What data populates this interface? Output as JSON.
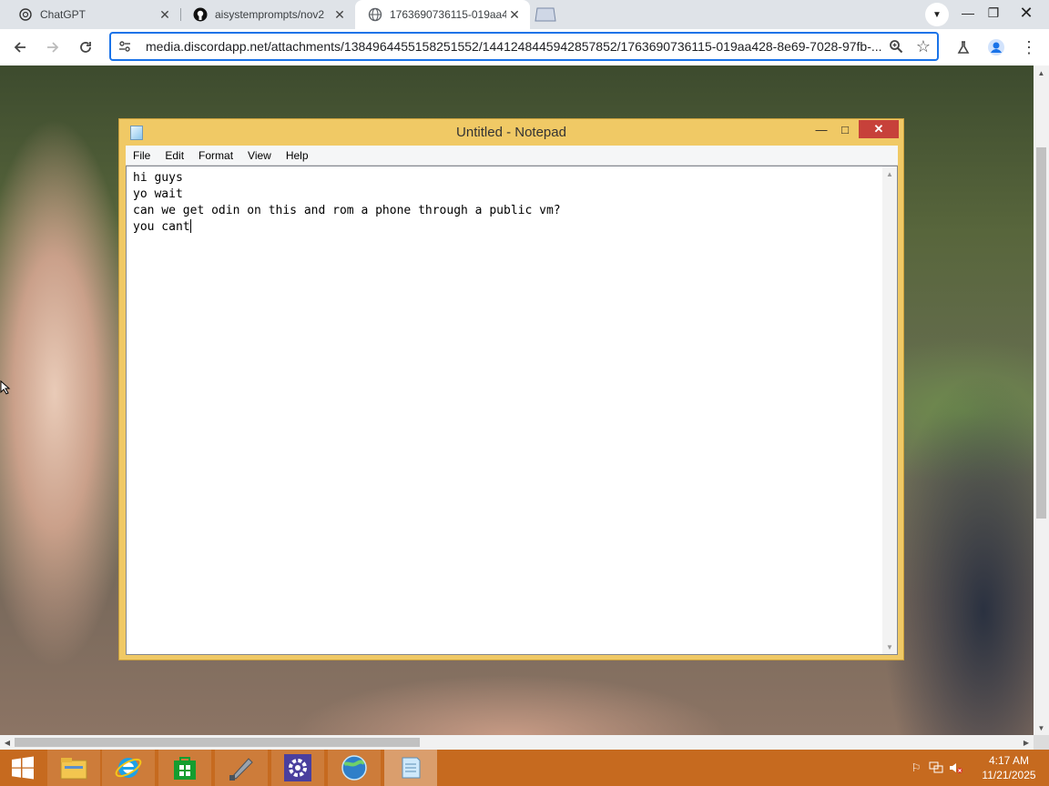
{
  "browser": {
    "tabs": [
      {
        "title": "ChatGPT",
        "favicon": "openai-icon"
      },
      {
        "title": "aisystemprompts/nov2",
        "favicon": "github-icon"
      },
      {
        "title": "1763690736115-019aa4",
        "favicon": "globe-icon",
        "active": true
      }
    ],
    "url": "media.discordapp.net/attachments/1384964455158251552/1441248445942857852/1763690736115-019aa428-8e69-7028-97fb-..."
  },
  "notepad": {
    "title": "Untitled - Notepad",
    "menu": [
      "File",
      "Edit",
      "Format",
      "View",
      "Help"
    ],
    "lines": [
      "hi guys",
      "yo wait",
      "can we get odin on this and rom a phone through a public vm?",
      "you cant"
    ]
  },
  "taskbar": {
    "apps": [
      "file-explorer-icon",
      "internet-explorer-icon",
      "store-icon",
      "tool-icon",
      "settings-icon",
      "browser-icon",
      "notepad-icon"
    ],
    "clock": {
      "time": "4:17 AM",
      "date": "11/21/2025"
    }
  },
  "colors": {
    "taskbar": "#c66a1f",
    "notepad_frame": "#f0c965",
    "close_button": "#c7413a",
    "omnibox_border": "#1a73e8"
  }
}
